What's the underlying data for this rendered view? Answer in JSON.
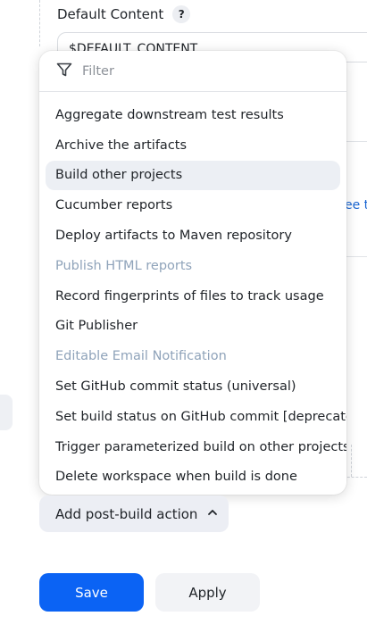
{
  "background": {
    "default_content_label": "Default Content",
    "help_badge": "?",
    "default_content_value": "$DEFAULT_CONTENT",
    "partial_link_text": "ee th"
  },
  "dropdown": {
    "filter_placeholder": "Filter",
    "filter_icon": "filter-funnel-icon",
    "items": [
      {
        "label": "Aggregate downstream test results",
        "state": "normal"
      },
      {
        "label": "Archive the artifacts",
        "state": "normal"
      },
      {
        "label": "Build other projects",
        "state": "highlighted"
      },
      {
        "label": "Cucumber reports",
        "state": "normal"
      },
      {
        "label": "Deploy artifacts to Maven repository",
        "state": "normal"
      },
      {
        "label": "Publish HTML reports",
        "state": "disabled"
      },
      {
        "label": "Record fingerprints of files to track usage",
        "state": "normal"
      },
      {
        "label": "Git Publisher",
        "state": "normal"
      },
      {
        "label": "Editable Email Notification",
        "state": "disabled"
      },
      {
        "label": "Set GitHub commit status (universal)",
        "state": "normal"
      },
      {
        "label": "Set build status on GitHub commit [deprecated]",
        "state": "normal"
      },
      {
        "label": "Trigger parameterized build on other projects",
        "state": "normal"
      },
      {
        "label": "Delete workspace when build is done",
        "state": "normal"
      }
    ]
  },
  "actions": {
    "add_post_build_label": "Add post-build action",
    "add_post_build_icon": "chevron-up-icon",
    "save_label": "Save",
    "apply_label": "Apply"
  },
  "colors": {
    "primary": "#0b63f4",
    "highlight": "#eceff4",
    "disabled_text": "#8fa3ba",
    "link": "#1a66d2"
  }
}
